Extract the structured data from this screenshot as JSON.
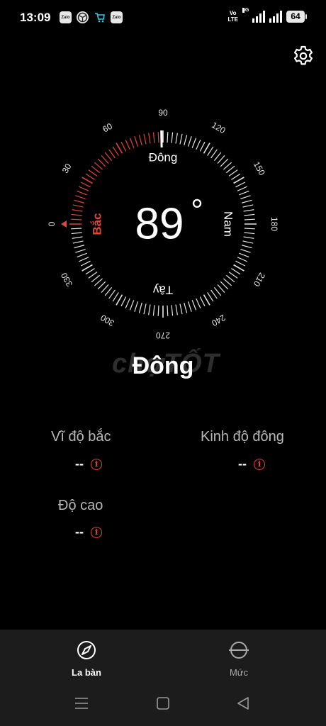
{
  "status_bar": {
    "time": "13:09",
    "notifications": [
      "Zalo",
      "Zalo"
    ],
    "volte_top": "Vo",
    "volte_bottom": "LTE",
    "network": "5G",
    "battery": "64"
  },
  "settings": {
    "icon": "gear-icon"
  },
  "compass": {
    "heading_value": "89",
    "degree_symbol": "°",
    "cardinals": {
      "north": "Bắc",
      "east": "Đông",
      "south": "Nam",
      "west": "Tây"
    },
    "degree_labels": [
      "0",
      "30",
      "60",
      "90",
      "120",
      "150",
      "180",
      "210",
      "240",
      "270",
      "300",
      "330"
    ],
    "accent_color": "#e0463a"
  },
  "direction_name": "Đông",
  "watermark": "chợTỐT",
  "info": {
    "latitude_label": "Vĩ độ bắc",
    "latitude_value": "--",
    "longitude_label": "Kinh độ đông",
    "longitude_value": "--",
    "altitude_label": "Độ cao",
    "altitude_value": "--",
    "info_symbol": "i"
  },
  "bottom_nav": {
    "compass_label": "La bàn",
    "level_label": "Mức"
  }
}
